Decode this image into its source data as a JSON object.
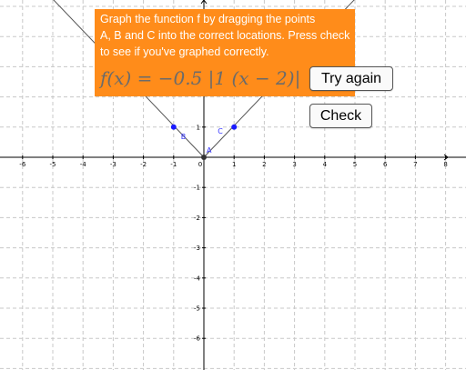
{
  "instructions": {
    "line1": "Graph the function f by dragging the points",
    "line2": "A, B and C into the correct locations.  Press check",
    "line3": "to see if you've graphed correctly."
  },
  "formula": "f(x) = −0.5 |1 (x − 2)|",
  "buttons": {
    "try_again": "Try again",
    "check": "Check"
  },
  "axes": {
    "x_ticks": [
      "-6",
      "-5",
      "-4",
      "-3",
      "-2",
      "-1",
      "0",
      "1",
      "2",
      "3",
      "4",
      "5",
      "6",
      "7",
      "8"
    ],
    "y_ticks_neg": [
      "-1",
      "-2",
      "-3",
      "-4",
      "-5",
      "-6"
    ],
    "y_ticks_pos": [
      "1"
    ]
  },
  "points": [
    {
      "name": "A",
      "x": 0,
      "y": 0
    },
    {
      "name": "B",
      "x": -1,
      "y": 1
    },
    {
      "name": "C",
      "x": 1,
      "y": 1
    }
  ],
  "colors": {
    "panel": "#ff8c1a",
    "point": "#1a1aff",
    "grid": "#c8c8c8"
  }
}
